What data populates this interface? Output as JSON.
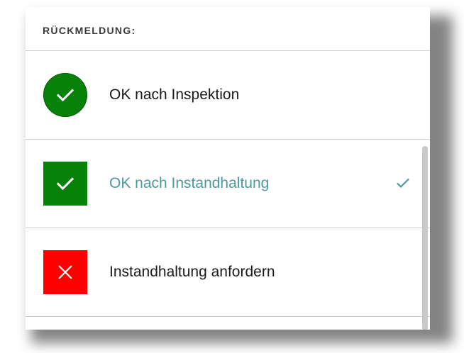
{
  "panel": {
    "title": "RÜCKMELDUNG:"
  },
  "options": [
    {
      "label": "OK nach Inspektion",
      "icon": "check-circle-icon",
      "icon_color": "#078107",
      "selected": false
    },
    {
      "label": "OK nach Instandhaltung",
      "icon": "check-square-icon",
      "icon_color": "#078107",
      "selected": true
    },
    {
      "label": "Instandhaltung anfordern",
      "icon": "x-square-icon",
      "icon_color": "#ff0000",
      "selected": false
    }
  ],
  "colors": {
    "selected_text": "#4c9a9e",
    "ok_green": "#078107",
    "error_red": "#ff0000"
  }
}
